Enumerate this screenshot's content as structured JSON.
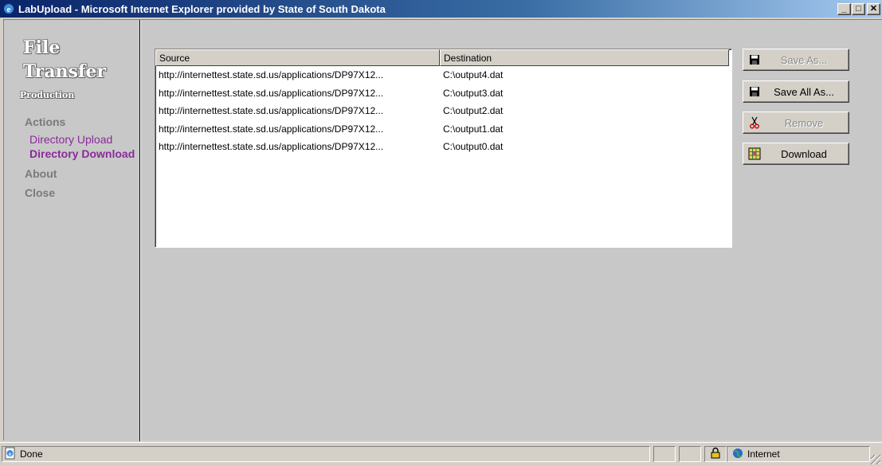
{
  "window": {
    "title": "LabUpload - Microsoft Internet Explorer provided by State of South Dakota",
    "minimize": "_",
    "maximize": "□",
    "close": "✕"
  },
  "sidebar": {
    "brand_line1": "File",
    "brand_line2": "Transfer",
    "brand_line3": "Production",
    "actions_heading": "Actions",
    "directory_upload": "Directory Upload",
    "directory_download": "Directory Download",
    "about": "About",
    "close": "Close"
  },
  "list": {
    "columns": [
      "Source",
      "Destination"
    ],
    "rows": [
      {
        "source": "http://internettest.state.sd.us/applications/DP97X12...",
        "destination": "C:\\output4.dat"
      },
      {
        "source": "http://internettest.state.sd.us/applications/DP97X12...",
        "destination": "C:\\output3.dat"
      },
      {
        "source": "http://internettest.state.sd.us/applications/DP97X12...",
        "destination": "C:\\output2.dat"
      },
      {
        "source": "http://internettest.state.sd.us/applications/DP97X12...",
        "destination": "C:\\output1.dat"
      },
      {
        "source": "http://internettest.state.sd.us/applications/DP97X12...",
        "destination": "C:\\output0.dat"
      }
    ]
  },
  "buttons": {
    "save_as": "Save As...",
    "save_all_as": "Save All As...",
    "remove": "Remove",
    "download": "Download"
  },
  "status": {
    "text": "Done",
    "zone": "Internet"
  },
  "colors": {
    "link_purple": "#8a2b9a",
    "title_bar": "#0a246a"
  }
}
